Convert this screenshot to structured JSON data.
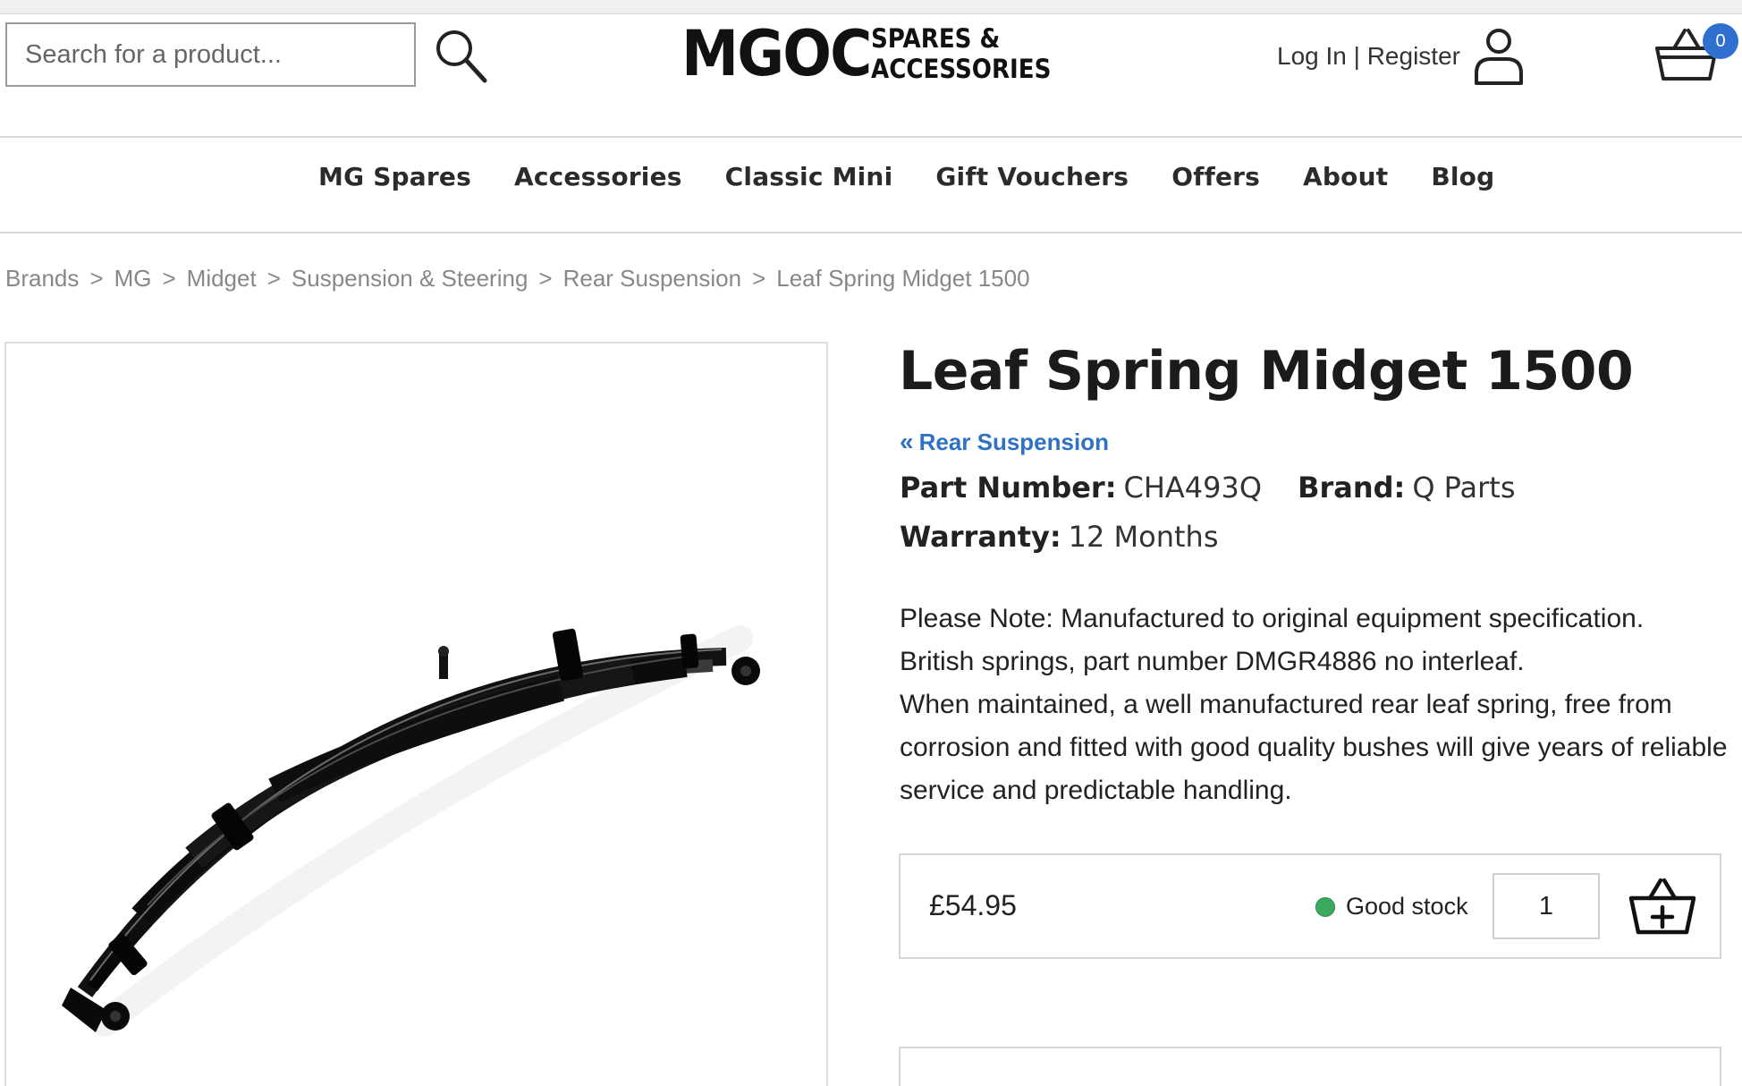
{
  "header": {
    "search": {
      "placeholder": "Search for a product...",
      "value": ""
    },
    "logo": {
      "main": "MGOC",
      "sub_line1": "SPARES &",
      "sub_line2": "ACCESSORIES"
    },
    "account": {
      "login": "Log In",
      "separator": " | ",
      "register": "Register"
    },
    "basket": {
      "count": "0"
    }
  },
  "nav": {
    "items": [
      "MG Spares",
      "Accessories",
      "Classic Mini",
      "Gift Vouchers",
      "Offers",
      "About",
      "Blog"
    ]
  },
  "breadcrumb": {
    "items": [
      "Brands",
      "MG",
      "Midget",
      "Suspension & Steering",
      "Rear Suspension",
      "Leaf Spring Midget 1500"
    ],
    "separator": ">"
  },
  "product": {
    "title": "Leaf Spring Midget 1500",
    "category_link": "Rear Suspension",
    "part_number_label": "Part Number:",
    "part_number": "CHA493Q",
    "brand_label": "Brand:",
    "brand": "Q Parts",
    "warranty_label": "Warranty:",
    "warranty": "12 Months",
    "description": [
      "Please Note: Manufactured to original equipment specification.",
      "British springs, part number DMGR4886 no interleaf.",
      "When maintained, a well manufactured rear leaf spring, free from corrosion and fitted with good quality bushes will give years of reliable service and predictable handling."
    ],
    "price": "£54.95",
    "stock_status": "Good stock",
    "stock_color": "#3caa5e",
    "quantity": "1"
  },
  "colors": {
    "link": "#2f72c4",
    "basket_badge": "#2f6fd0"
  },
  "icons": {
    "search": "search-icon",
    "user": "user-icon",
    "basket": "basket-icon",
    "add_to_basket": "add-to-basket-icon",
    "back_chevron": "double-chevron-left-icon"
  }
}
